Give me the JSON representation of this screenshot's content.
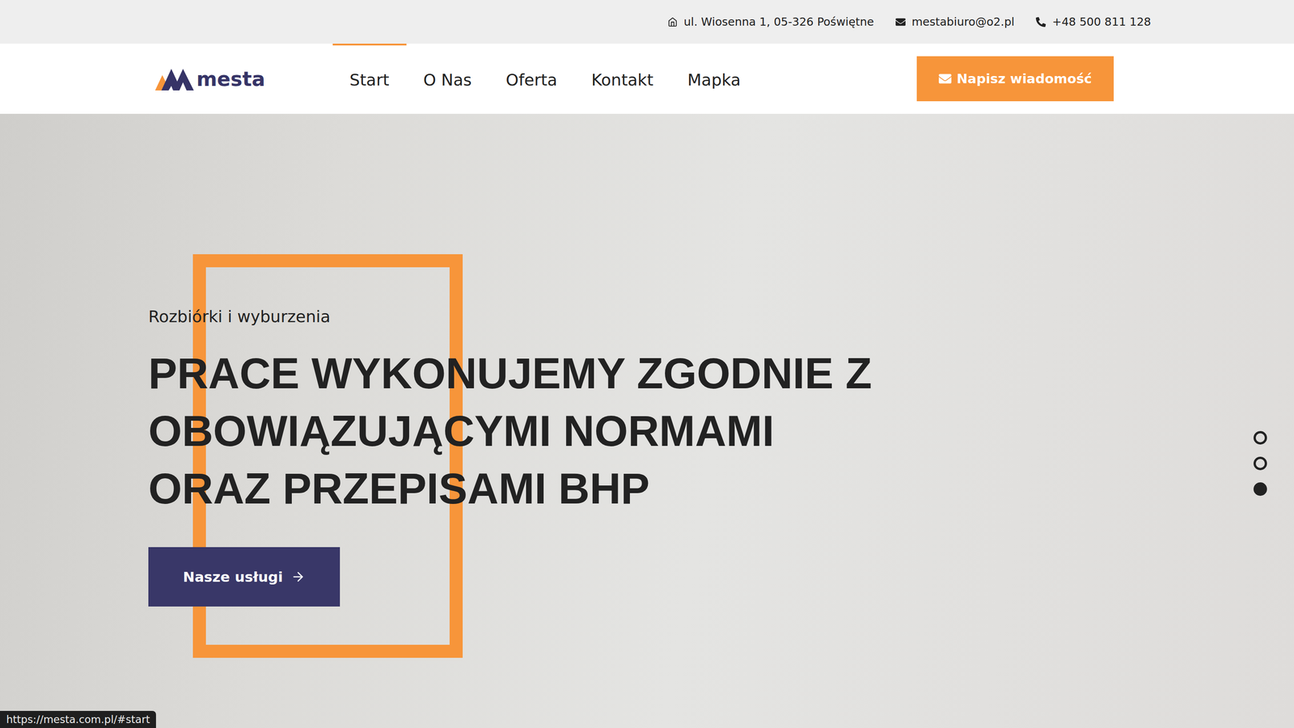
{
  "topbar": {
    "address": "ul. Wiosenna 1, 05-326 Poświętne",
    "email": "mestabiuro@o2.pl",
    "phone": "+48 500 811 128"
  },
  "logo": {
    "text": "mesta"
  },
  "nav": [
    {
      "label": "Start",
      "selected": true
    },
    {
      "label": "O Nas",
      "selected": false
    },
    {
      "label": "Oferta",
      "selected": false
    },
    {
      "label": "Kontakt",
      "selected": false
    },
    {
      "label": "Mapka",
      "selected": false
    }
  ],
  "cta": {
    "label": "Napisz wiadomość"
  },
  "hero": {
    "subtitle": "Rozbiórki i wyburzenia",
    "headline": [
      "PRACE WYKONUJEMY ZGODNIE Z",
      "OBOWIĄZUJĄCYMI NORMAMI",
      "ORAZ PRZEPISAMI BHP"
    ],
    "button": "Nasze usługi"
  },
  "slides": [
    {
      "selected": false
    },
    {
      "selected": false
    },
    {
      "selected": true
    }
  ],
  "status_bar": {
    "url": "https://mesta.com.pl/#start"
  }
}
